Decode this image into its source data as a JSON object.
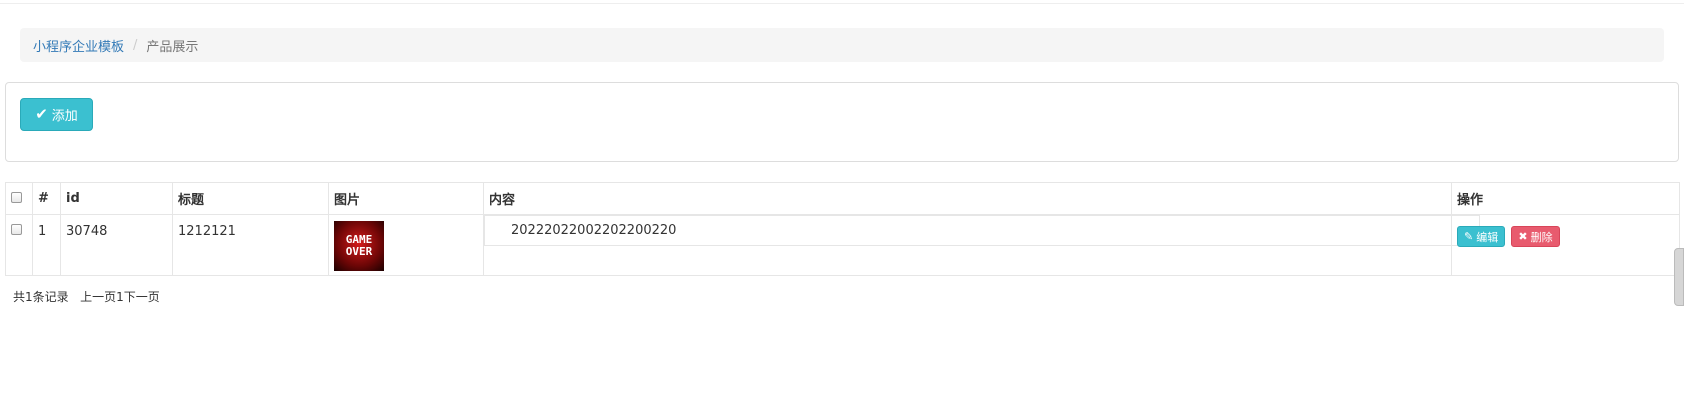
{
  "breadcrumb": {
    "home": "小程序企业模板",
    "separator": "/",
    "current": "产品展示"
  },
  "toolbar": {
    "add_label": "添加",
    "add_icon": "check-icon"
  },
  "table": {
    "headers": {
      "number": "#",
      "id": "id",
      "title": "标题",
      "image": "图片",
      "content": "内容",
      "action": "操作"
    },
    "rows": [
      {
        "number": "1",
        "id": "30748",
        "title": "1212121",
        "image_text": [
          "GAME",
          "OVER"
        ],
        "content": "20222022002202200220"
      }
    ],
    "actions": {
      "edit": "编辑",
      "delete": "删除",
      "edit_icon": "edit-icon",
      "delete_icon": "close-icon"
    }
  },
  "pager": {
    "total": "共1条记录",
    "prev": "上一页",
    "page": "1",
    "next": "下一页"
  },
  "colors": {
    "link": "#337ab7",
    "accent": "#3bc0d0",
    "danger": "#e85b6e"
  }
}
